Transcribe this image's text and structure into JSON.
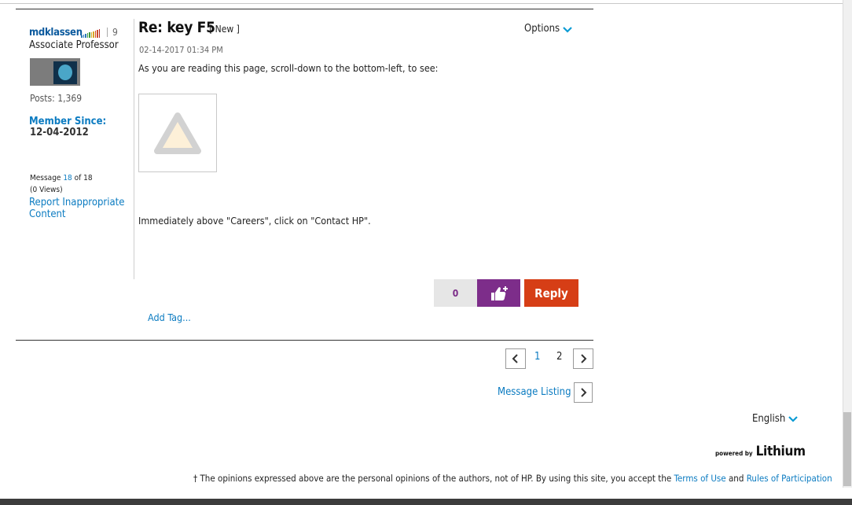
{
  "author": {
    "name": "mdklassen",
    "kudos": "9",
    "rank": "Associate Professor",
    "posts": "Posts: 1,369",
    "member_since_label": "Member Since:",
    "member_since_date": "12-04-2012",
    "message_prefix": "Message",
    "message_number": "18",
    "message_suffix": "of 18",
    "views": "(0 Views)",
    "report_link": "Report Inappropriate Content",
    "rank_bar_colors": [
      "#2a78b8",
      "#2a78b8",
      "#2a78b8",
      "#3f9c3f",
      "#3f9c3f",
      "#d8a526",
      "#d8a526",
      "#d04a2a",
      "#d04a2a",
      "#b02a2a"
    ]
  },
  "post": {
    "title": "Re: key F5",
    "badge": "[ New ]",
    "date": "02-14-2017 01:34 PM",
    "options_label": "Options",
    "paragraph1": "As you are reading this page, scroll-down to the bottom-left, to see:",
    "paragraph2": "Immediately above \"Careers\", click on \"Contact HP\".",
    "kudos_count": "0",
    "reply_label": "Reply",
    "add_tag_label": "Add Tag..."
  },
  "pagination": {
    "page1": "1",
    "page2": "2",
    "message_listing": "Message Listing"
  },
  "footer": {
    "language": "English",
    "powered_by": "powered by",
    "brand": "Lithium",
    "disclaimer_text": "† The opinions expressed above are the personal opinions of the authors, not of HP. By using this site, you accept the ",
    "terms_link": "Terms of Use",
    "and": " and ",
    "rules_link": "Rules of Participation"
  },
  "colors": {
    "link": "#0b7bc1",
    "kudos_purple": "#7d2d8a",
    "reply_orange": "#d63e16"
  }
}
